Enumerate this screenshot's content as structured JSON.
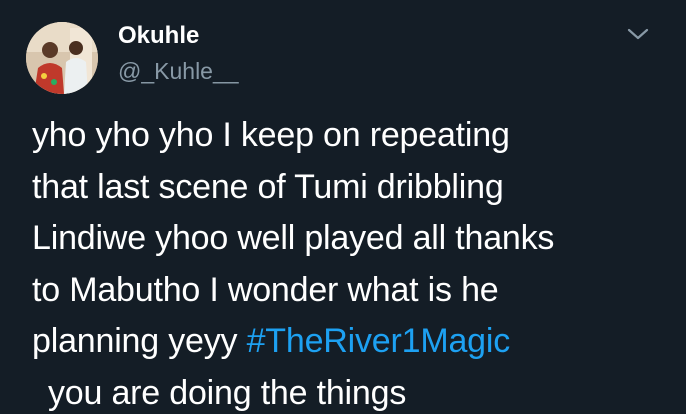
{
  "tweet": {
    "user": {
      "display_name": "Okuhle",
      "handle": "@_Kuhle__",
      "avatar_icon": "profile-photo"
    },
    "menu_icon": "chevron-down-icon",
    "body": {
      "line1": "yho yho yho I keep on repeating",
      "line2": "that last scene of Tumi dribbling",
      "line3": "Lindiwe yhoo well played all thanks",
      "line4": "to Mabutho I wonder what is he",
      "line5_text": "planning yeyy ",
      "hashtag": "#TheRiver1Magic",
      "line6": "you are doing the things"
    },
    "colors": {
      "background": "#141d26",
      "text": "#ffffff",
      "secondary": "#8899a6",
      "link": "#1da1f2"
    }
  }
}
